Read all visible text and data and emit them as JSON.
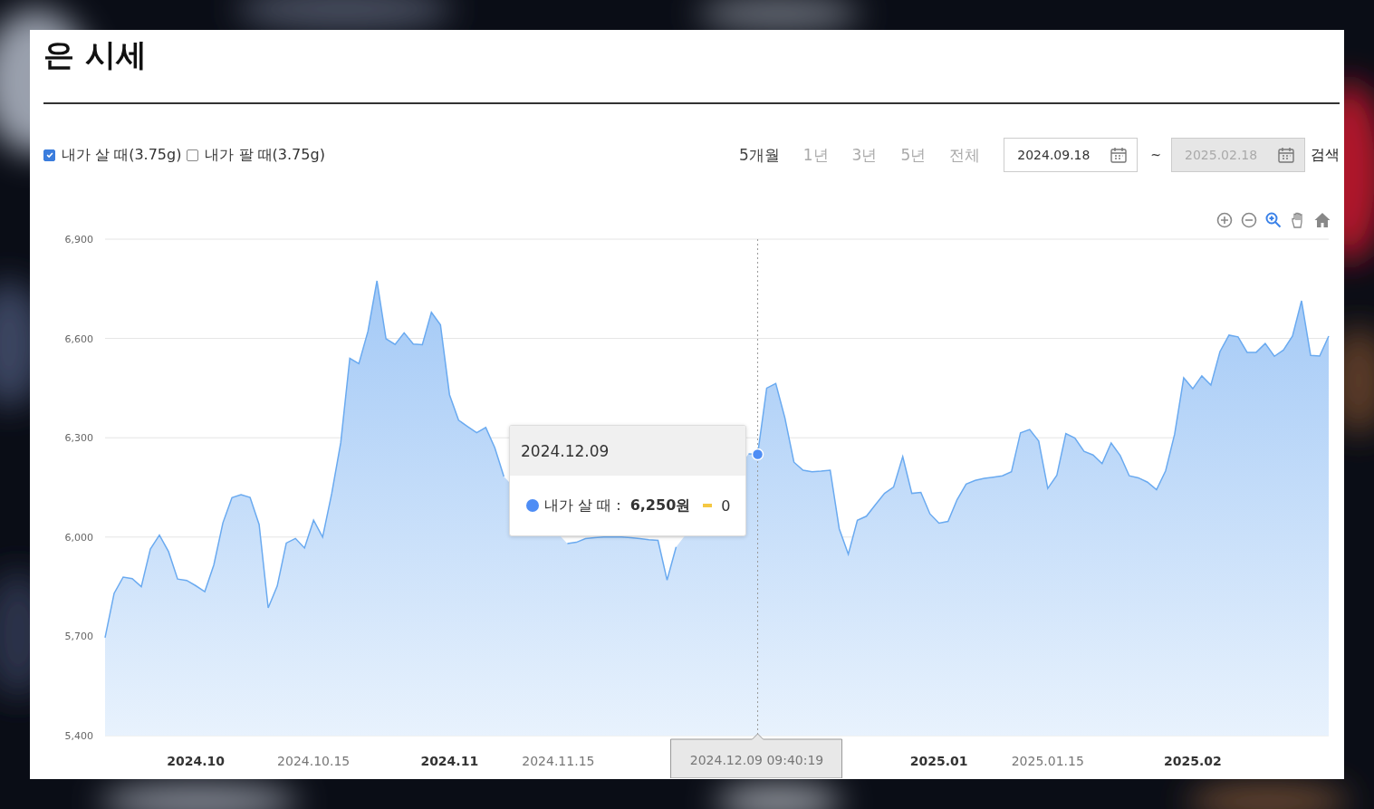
{
  "title": "은 시세",
  "filters": [
    {
      "label": "내가 살 때(3.75g)",
      "checked": true
    },
    {
      "label": "내가 팔 때(3.75g)",
      "checked": false
    }
  ],
  "periods": [
    {
      "label": "5개월",
      "selected": true
    },
    {
      "label": "1년",
      "selected": false
    },
    {
      "label": "3년",
      "selected": false
    },
    {
      "label": "5년",
      "selected": false
    },
    {
      "label": "전체",
      "selected": false
    }
  ],
  "date_from": {
    "value": "2024.09.18",
    "disabled": false
  },
  "date_separator": "~",
  "date_to": {
    "value": "2025.02.18",
    "disabled": true
  },
  "search_button": "검색",
  "chart_tools": [
    {
      "kind": "zoom-in",
      "selected": false
    },
    {
      "kind": "zoom-out",
      "selected": false
    },
    {
      "kind": "magnifier",
      "selected": true
    },
    {
      "kind": "hand",
      "selected": false
    },
    {
      "kind": "home",
      "selected": false
    }
  ],
  "chart_data": {
    "type": "area",
    "ylim": [
      5400,
      6900
    ],
    "grid": true,
    "yticks": [
      {
        "value": 5400,
        "label": "5,400"
      },
      {
        "value": 5700,
        "label": "5,700"
      },
      {
        "value": 6000,
        "label": "6,000"
      },
      {
        "value": 6300,
        "label": "6,300"
      },
      {
        "value": 6600,
        "label": "6,600"
      },
      {
        "value": 6900,
        "label": "6,900"
      }
    ],
    "categories": [
      null,
      null,
      null,
      null,
      null,
      null,
      null,
      null,
      null,
      null,
      "2024.10",
      null,
      null,
      null,
      null,
      null,
      null,
      null,
      null,
      null,
      null,
      null,
      null,
      "2024.10.15",
      null,
      null,
      null,
      null,
      null,
      null,
      null,
      null,
      null,
      null,
      null,
      null,
      null,
      null,
      "2024.11",
      null,
      null,
      null,
      null,
      null,
      null,
      null,
      null,
      null,
      null,
      null,
      "2024.11.15",
      null,
      null,
      null,
      null,
      null,
      null,
      null,
      null,
      null,
      null,
      null,
      null,
      null,
      null,
      null,
      null,
      null,
      null,
      null,
      null,
      null,
      "2024.12.09 09:40:19",
      null,
      null,
      null,
      null,
      null,
      null,
      null,
      null,
      null,
      null,
      null,
      null,
      null,
      null,
      null,
      null,
      null,
      null,
      null,
      "2025.01",
      null,
      null,
      null,
      null,
      null,
      null,
      null,
      null,
      null,
      null,
      null,
      "2025.01.15",
      null,
      null,
      null,
      null,
      null,
      null,
      null,
      null,
      null,
      null,
      null,
      null,
      null,
      null,
      null,
      "2025.02",
      null,
      null,
      null,
      null,
      null,
      null,
      null,
      null,
      null,
      null,
      null,
      null,
      null,
      null,
      null
    ],
    "series": [
      {
        "color": "#6aaaf0",
        "values": [
          5696,
          5830,
          5879,
          5874,
          5850,
          5964,
          6006,
          5956,
          5873,
          5869,
          5853,
          5835,
          5916,
          6043,
          6119,
          6128,
          6120,
          6038,
          5786,
          5852,
          5982,
          5996,
          5967,
          6051,
          6000,
          6131,
          6285,
          6540,
          6524,
          6621,
          6774,
          6599,
          6582,
          6617,
          6583,
          6581,
          6679,
          6641,
          6430,
          6353,
          6334,
          6315,
          6331,
          6270,
          6183,
          null,
          null,
          null,
          null,
          null,
          null,
          5980,
          5984,
          5995,
          5998,
          6000,
          6000,
          6000,
          5998,
          5995,
          5992,
          5990,
          5870,
          5970,
          null,
          null,
          null,
          null,
          null,
          null,
          null,
          6251,
          6250,
          6450,
          6464,
          6360,
          6226,
          6202,
          6197,
          6199,
          6202,
          6025,
          5948,
          6051,
          6063,
          6098,
          6132,
          6151,
          6243,
          6132,
          6135,
          6070,
          6042,
          6047,
          6113,
          6160,
          6171,
          6177,
          6181,
          6185,
          6197,
          6315,
          6325,
          6290,
          6147,
          6186,
          6313,
          6299,
          6259,
          6248,
          6222,
          6284,
          6246,
          6185,
          6179,
          6166,
          6143,
          6200,
          6311,
          6481,
          6448,
          6487,
          6459,
          6560,
          6610,
          6605,
          6558,
          6558,
          6585,
          6546,
          6565,
          6607,
          6714,
          6549,
          6547,
          6607
        ]
      }
    ],
    "annotations": [
      {
        "x": "2024.12.09 09:40:19"
      }
    ]
  },
  "tooltip": {
    "date": "2024.12.09",
    "series_label": "내가 살 때 :",
    "value": "6,250원",
    "extra": "0"
  }
}
